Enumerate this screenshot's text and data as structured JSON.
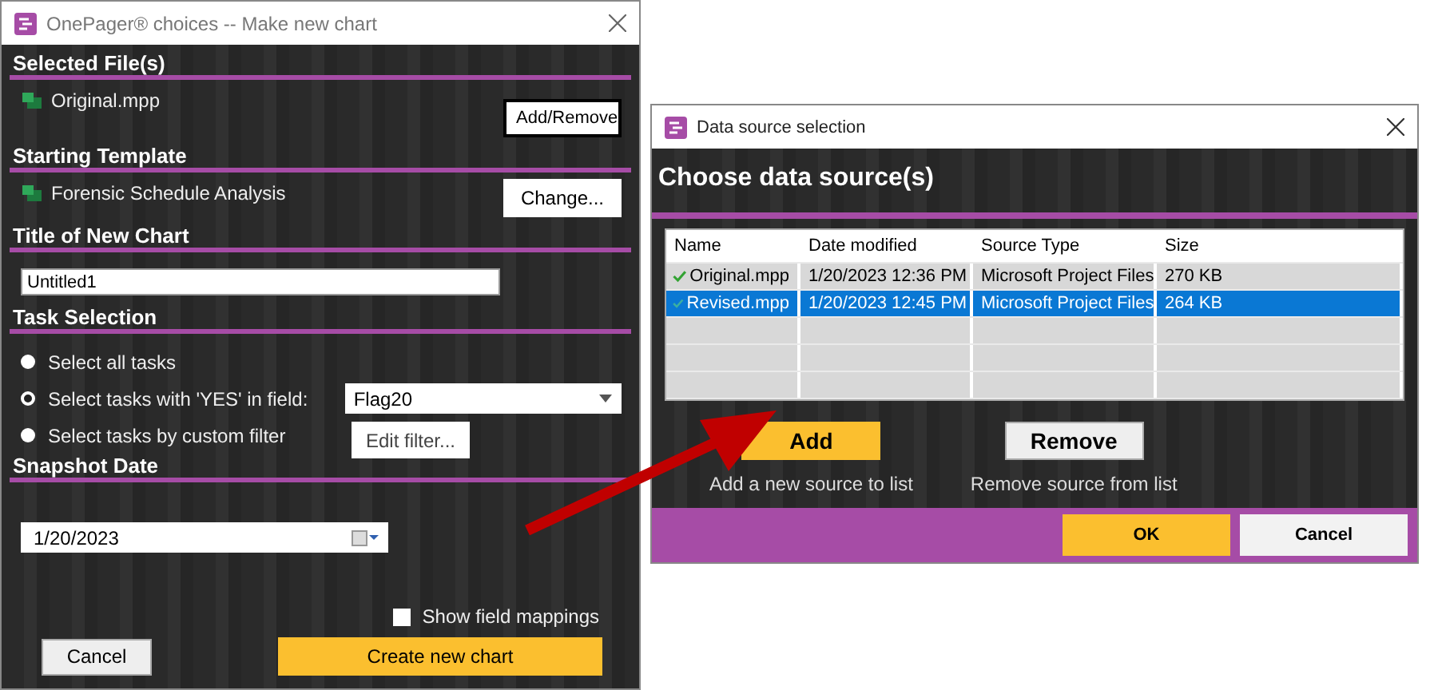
{
  "main_window": {
    "title": "OnePager® choices -- Make new chart",
    "selected_files": {
      "heading": "Selected File(s)",
      "files": [
        "Original.mpp"
      ],
      "button": "Add/Remove"
    },
    "starting_template": {
      "heading": "Starting Template",
      "template": "Forensic Schedule Analysis",
      "button": "Change..."
    },
    "chart_title": {
      "heading": "Title of New Chart",
      "value": "Untitled1"
    },
    "task_selection": {
      "heading": "Task Selection",
      "options": [
        {
          "label": "Select all tasks",
          "selected": false
        },
        {
          "label": "Select tasks with 'YES' in field:",
          "selected": true
        },
        {
          "label": "Select tasks by custom filter",
          "selected": false
        }
      ],
      "field_value": "Flag20",
      "filter_button": "Edit filter..."
    },
    "snapshot_date": {
      "heading": "Snapshot Date",
      "value": "1/20/2023"
    },
    "show_field_mappings": {
      "label": "Show field mappings",
      "checked": false
    },
    "buttons": {
      "cancel": "Cancel",
      "create": "Create new chart"
    }
  },
  "data_source_window": {
    "title": "Data source selection",
    "heading": "Choose data source(s)",
    "columns": [
      "Name",
      "Date modified",
      "Source Type",
      "Size"
    ],
    "rows": [
      {
        "name": "Original.mpp",
        "date": "1/20/2023 12:36 PM",
        "type": "Microsoft Project Files",
        "size": "270 KB",
        "checked": true,
        "selected": false
      },
      {
        "name": "Revised.mpp",
        "date": "1/20/2023 12:45 PM",
        "type": "Microsoft Project Files",
        "size": "264 KB",
        "checked": true,
        "selected": true
      }
    ],
    "add": {
      "button": "Add",
      "caption": "Add a new source to list"
    },
    "remove": {
      "button": "Remove",
      "caption": "Remove source from list"
    },
    "ok": "OK",
    "cancel": "Cancel"
  }
}
